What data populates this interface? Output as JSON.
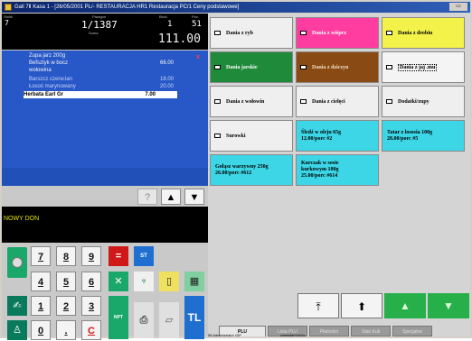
{
  "window": {
    "title": "Gall 7Ⅱ Kasa 1 - [26/05/2001 PL/- RESTAURACJA  HR1 Restauracja PC/1 Ceny podstawowe]",
    "controls": "▭"
  },
  "counter": {
    "stolik_label": "Stolik",
    "stolik_value": "7",
    "paragon_label": "Paragon",
    "paragon_value": "1/1387",
    "suma_label": "Suma",
    "bloki_label": "Bloki",
    "bloki_value": "1",
    "poz_label": "Poz.",
    "poz_value": "51",
    "total": "111.00"
  },
  "receipt": {
    "lines": [
      {
        "name": "Zupa jarz 200g",
        "price": ""
      },
      {
        "name": "Befsztyk w bocz",
        "price": "66.00"
      },
      {
        "name": "wołowina",
        "price": ""
      },
      {
        "name": "Barszcz czerw.lan",
        "price": "18.00"
      },
      {
        "name": "Łosoś marynowany",
        "price": "20.00"
      },
      {
        "name": "Herbata Earl Gr",
        "price": "7.00"
      }
    ],
    "x_mark": "x"
  },
  "controls": {
    "help": "?",
    "up": "▲",
    "down": "▼"
  },
  "status_text": "NOWY DON",
  "keypad": {
    "numbers": [
      "7",
      "8",
      "9",
      "4",
      "5",
      "6",
      "1",
      "2",
      "3",
      "0",
      ".",
      "C"
    ],
    "icons": [
      "=",
      "ST",
      "NPT",
      "TL"
    ]
  },
  "tiles": [
    {
      "label": "Dania z ryb"
    },
    {
      "label": "Dania z wiśprz"
    },
    {
      "label": "Dania z drobiu"
    },
    {
      "label": "Dania jarskie"
    },
    {
      "label": "Dania z dziczyn"
    },
    {
      "label": "Dania z jaj .mu"
    },
    {
      "label": "Dania z wołowin"
    },
    {
      "label": "Dania z cielęci"
    },
    {
      "label": "Dodatki/zupy"
    },
    {
      "label": "Surowki"
    },
    {
      "line1": "Śledź w oleju 65g",
      "line2": "12.00/porc #2"
    },
    {
      "line1": "Tatar z łososia 100g",
      "line2": "28.00/porc #5"
    },
    {
      "line1": "Gołąsz warzywny 250g",
      "line2": "26.00/porc #612"
    },
    {
      "line1": "Kurczak w sosie",
      "line2": "kurkowym 180g",
      "line3": "25.00/porc #614"
    }
  ],
  "nav": {
    "first": "⤒",
    "up_fast": "⬆",
    "up": "▲",
    "down": "▼"
  },
  "tabs": [
    "PLU",
    "Lista PLU",
    "Płatności",
    "Stan Kuli",
    "Specjalne"
  ],
  "footer": {
    "user": "58  Administrator  GIP",
    "info": "c/wewidr/Gh/2s"
  },
  "colors": {
    "receipt_bg": "#2858c8",
    "counter_bg": "#000000",
    "status_yellow": "#e6e600",
    "tile_pink": "#ff3ca0",
    "tile_yellow": "#f2f24a",
    "tile_green": "#1f8a3a",
    "tile_brown": "#8a4a14",
    "tile_cyan": "#3cd6e6",
    "nav_green": "#27b04a"
  }
}
